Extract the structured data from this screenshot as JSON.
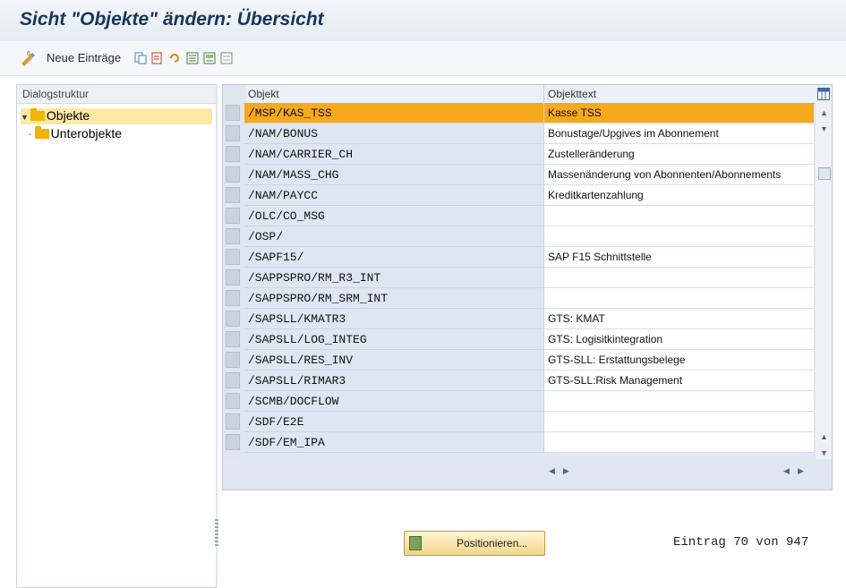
{
  "window": {
    "title": "Sicht \"Objekte\" ändern: Übersicht"
  },
  "toolbar": {
    "new_entries_label": "Neue Einträge"
  },
  "dialog_structure": {
    "header": "Dialogstruktur",
    "items": [
      {
        "label": "Objekte",
        "selected": true
      },
      {
        "label": "Unterobjekte",
        "selected": false
      }
    ]
  },
  "table": {
    "headers": {
      "object": "Objekt",
      "object_text": "Objekttext"
    },
    "rows": [
      {
        "object": "/MSP/KAS_TSS",
        "text": "Kasse TSS",
        "selected": true
      },
      {
        "object": "/NAM/BONUS",
        "text": "Bonustage/Upgives im Abonnement"
      },
      {
        "object": "/NAM/CARRIER_CH",
        "text": "Zustelleränderung"
      },
      {
        "object": "/NAM/MASS_CHG",
        "text": "Massenänderung von Abonnenten/Abonnements"
      },
      {
        "object": "/NAM/PAYCC",
        "text": "Kreditkartenzahlung"
      },
      {
        "object": "/OLC/CO_MSG",
        "text": ""
      },
      {
        "object": "/OSP/",
        "text": ""
      },
      {
        "object": "/SAPF15/",
        "text": "SAP F15 Schnittstelle"
      },
      {
        "object": "/SAPPSPRO/RM_R3_INT",
        "text": ""
      },
      {
        "object": "/SAPPSPRO/RM_SRM_INT",
        "text": ""
      },
      {
        "object": "/SAPSLL/KMATR3",
        "text": "GTS: KMAT"
      },
      {
        "object": "/SAPSLL/LOG_INTEG",
        "text": "GTS: Logisitkintegration"
      },
      {
        "object": "/SAPSLL/RES_INV",
        "text": "GTS-SLL: Erstattungsbelege"
      },
      {
        "object": "/SAPSLL/RIMAR3",
        "text": "GTS-SLL:Risk Management"
      },
      {
        "object": "/SCMB/DOCFLOW",
        "text": ""
      },
      {
        "object": "/SDF/E2E",
        "text": ""
      },
      {
        "object": "/SDF/EM_IPA",
        "text": ""
      }
    ]
  },
  "footer": {
    "position_button": "Positionieren...",
    "entry_status": "Eintrag 70 von 947"
  },
  "colors": {
    "selection": "#f6a91d",
    "tree_selection": "#fde9a4",
    "title": "#17365d"
  }
}
